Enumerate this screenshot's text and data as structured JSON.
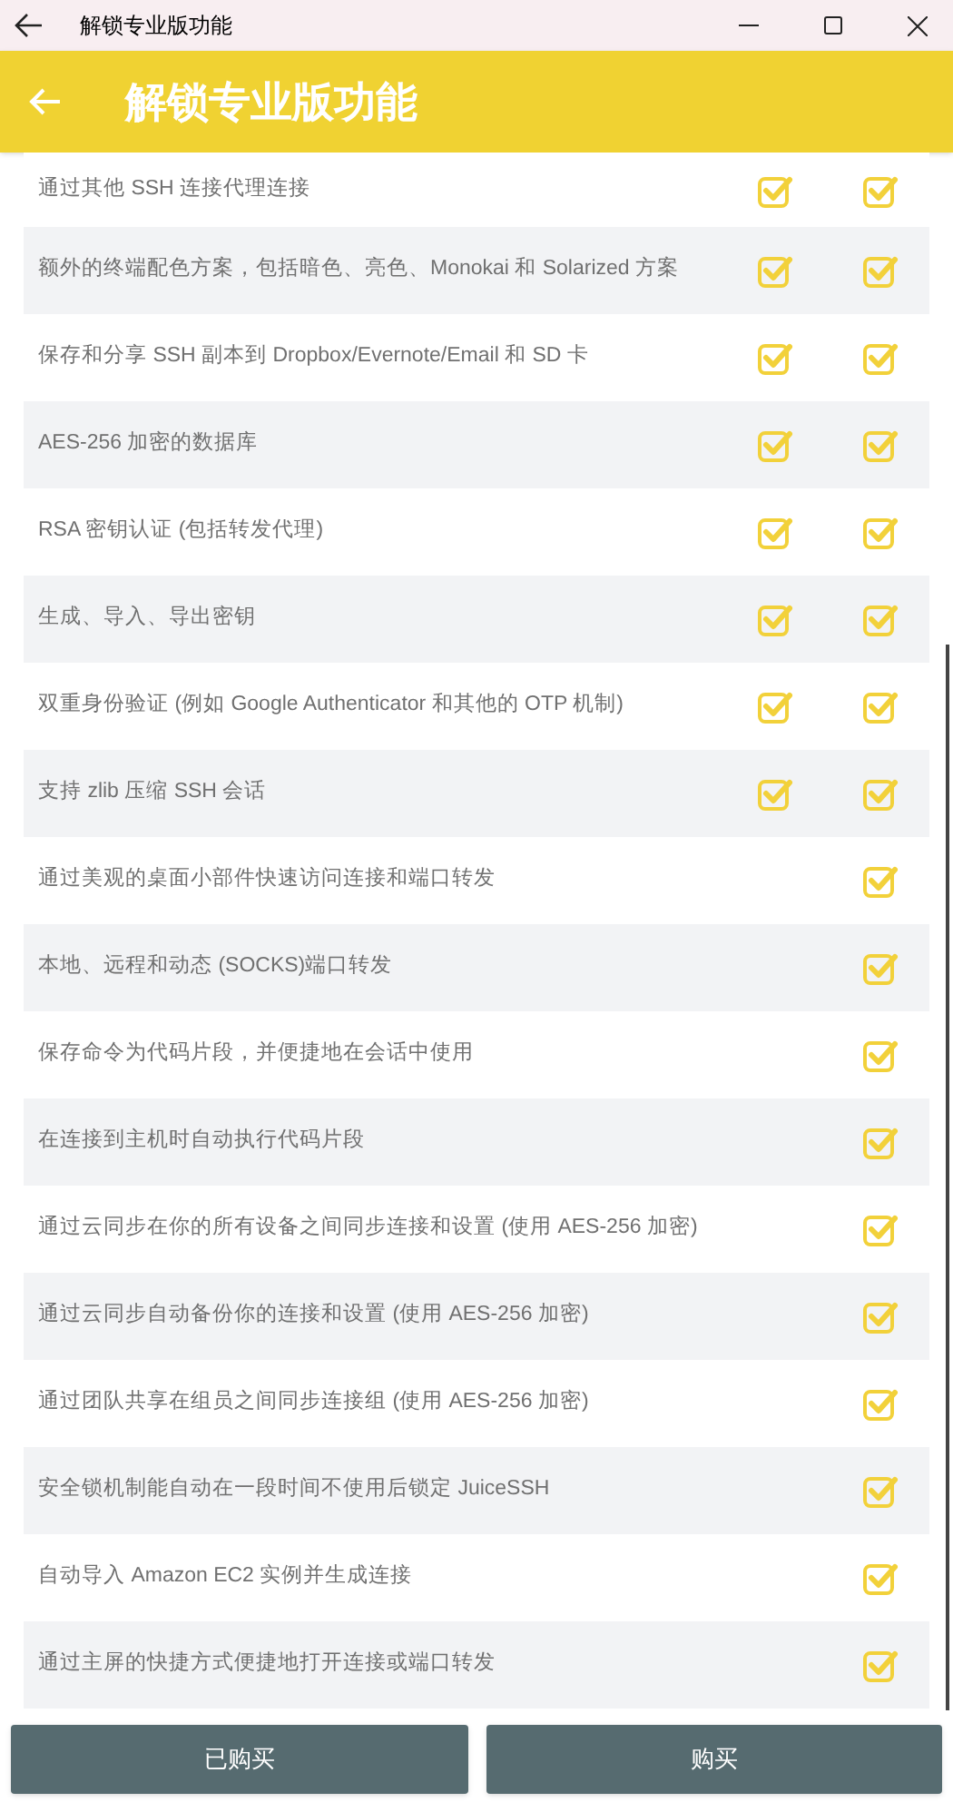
{
  "window": {
    "title": "解锁专业版功能"
  },
  "app_bar": {
    "title": "解锁专业版功能"
  },
  "features": [
    {
      "label": "通过其他 SSH 连接代理连接",
      "free": true,
      "pro": true
    },
    {
      "label": "额外的终端配色方案，包括暗色、亮色、Monokai 和 Solarized 方案",
      "free": true,
      "pro": true
    },
    {
      "label": "保存和分享 SSH 副本到 Dropbox/Evernote/Email 和 SD 卡",
      "free": true,
      "pro": true
    },
    {
      "label": "AES-256 加密的数据库",
      "free": true,
      "pro": true
    },
    {
      "label": "RSA 密钥认证 (包括转发代理)",
      "free": true,
      "pro": true
    },
    {
      "label": "生成、导入、导出密钥",
      "free": true,
      "pro": true
    },
    {
      "label": "双重身份验证 (例如 Google Authenticator 和其他的 OTP 机制)",
      "free": true,
      "pro": true
    },
    {
      "label": "支持 zlib 压缩 SSH 会话",
      "free": true,
      "pro": true
    },
    {
      "label": "通过美观的桌面小部件快速访问连接和端口转发",
      "free": false,
      "pro": true
    },
    {
      "label": "本地、远程和动态 (SOCKS)端口转发",
      "free": false,
      "pro": true
    },
    {
      "label": "保存命令为代码片段，并便捷地在会话中使用",
      "free": false,
      "pro": true
    },
    {
      "label": "在连接到主机时自动执行代码片段",
      "free": false,
      "pro": true
    },
    {
      "label": "通过云同步在你的所有设备之间同步连接和设置 (使用 AES-256 加密)",
      "free": false,
      "pro": true
    },
    {
      "label": "通过云同步自动备份你的连接和设置 (使用 AES-256 加密)",
      "free": false,
      "pro": true
    },
    {
      "label": "通过团队共享在组员之间同步连接组 (使用 AES-256 加密)",
      "free": false,
      "pro": true
    },
    {
      "label": "安全锁机制能自动在一段时间不使用后锁定 JuiceSSH",
      "free": false,
      "pro": true
    },
    {
      "label": "自动导入 Amazon EC2 实例并生成连接",
      "free": false,
      "pro": true
    },
    {
      "label": "通过主屏的快捷方式便捷地打开连接或端口转发",
      "free": false,
      "pro": true
    }
  ],
  "buttons": [
    "已购买",
    "购买"
  ]
}
